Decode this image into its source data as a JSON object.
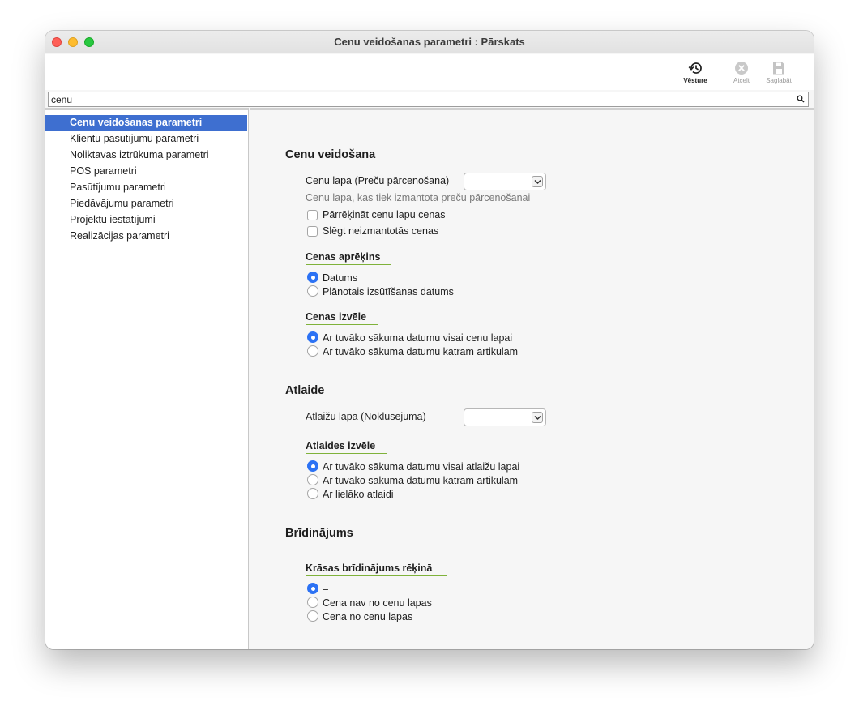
{
  "window": {
    "title": "Cenu veidošanas parametri : Pārskats"
  },
  "toolbar": {
    "history_label": "Vēsture",
    "cancel_label": "Atcelt",
    "save_label": "Saglabāt"
  },
  "search": {
    "value": "cenu"
  },
  "sidebar": {
    "items": [
      {
        "label": "Cenu veidošanas parametri",
        "active": true
      },
      {
        "label": "Klientu pasūtījumu parametri"
      },
      {
        "label": "Noliktavas iztrūkuma parametri"
      },
      {
        "label": "POS parametri"
      },
      {
        "label": "Pasūtījumu parametri"
      },
      {
        "label": "Piedāvājumu parametri"
      },
      {
        "label": "Projektu iestatījumi"
      },
      {
        "label": "Realizācijas parametri"
      }
    ]
  },
  "main": {
    "pricing": {
      "title": "Cenu veidošana",
      "price_list_label": "Cenu lapa (Preču pārcenošana)",
      "price_list_value": "",
      "price_list_hint": "Cenu lapa, kas tiek izmantota preču pārcenošanai",
      "recalc_label": "Pārrēķināt cenu lapu cenas",
      "recalc_checked": false,
      "close_unused_label": "Slēgt neizmantotās cenas",
      "close_unused_checked": false,
      "calc": {
        "title": "Cenas aprēķins",
        "options": [
          "Datums",
          "Plānotais izsūtīšanas datums"
        ],
        "selected": 0
      },
      "choice": {
        "title": "Cenas izvēle",
        "options": [
          "Ar tuvāko sākuma datumu visai cenu lapai",
          "Ar tuvāko sākuma datumu katram artikulam"
        ],
        "selected": 0
      }
    },
    "discount": {
      "title": "Atlaide",
      "list_label": "Atlaižu lapa (Noklusējuma)",
      "list_value": "",
      "choice": {
        "title": "Atlaides izvēle",
        "options": [
          "Ar tuvāko sākuma datumu visai atlaižu lapai",
          "Ar tuvāko sākuma datumu katram artikulam",
          "Ar lielāko atlaidi"
        ],
        "selected": 0
      }
    },
    "warning": {
      "title": "Brīdinājums",
      "color": {
        "title": "Krāsas brīdinājums rēķinā",
        "options": [
          "–",
          "Cena nav no cenu lapas",
          "Cena no cenu lapas"
        ],
        "selected": 0
      }
    }
  },
  "colors": {
    "accent": "#2c72f4",
    "sidebar_selection": "#3e6fd0",
    "subheading_underline": "#7fb23a"
  }
}
